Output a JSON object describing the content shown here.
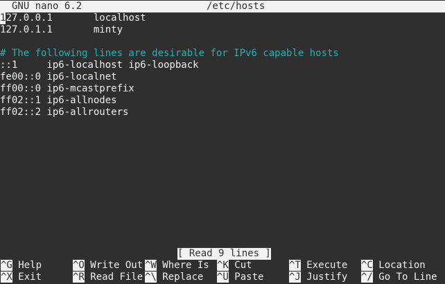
{
  "titlebar": {
    "app": "GNU nano 6.2",
    "file": "/etc/hosts"
  },
  "editor": {
    "cursor_char": "1",
    "lines": [
      {
        "text": "27.0.0.1       localhost",
        "comment": false
      },
      {
        "text": "127.0.1.1       minty",
        "comment": false
      },
      {
        "text": "",
        "comment": false
      },
      {
        "text": "# The following lines are desirable for IPv6 capable hosts",
        "comment": true
      },
      {
        "text": "::1     ip6-localhost ip6-loopback",
        "comment": false
      },
      {
        "text": "fe00::0 ip6-localnet",
        "comment": false
      },
      {
        "text": "ff00::0 ip6-mcastprefix",
        "comment": false
      },
      {
        "text": "ff02::1 ip6-allnodes",
        "comment": false
      },
      {
        "text": "ff02::2 ip6-allrouters",
        "comment": false
      }
    ]
  },
  "status": {
    "message": "[ Read 9 lines ]"
  },
  "shortcuts": {
    "row1": [
      {
        "key": "^G",
        "label": "Help"
      },
      {
        "key": "^O",
        "label": "Write Out"
      },
      {
        "key": "^W",
        "label": "Where Is"
      },
      {
        "key": "^K",
        "label": "Cut"
      },
      {
        "key": "^T",
        "label": "Execute"
      },
      {
        "key": "^C",
        "label": "Location"
      }
    ],
    "row2": [
      {
        "key": "^X",
        "label": "Exit"
      },
      {
        "key": "^R",
        "label": "Read File"
      },
      {
        "key": "^\\",
        "label": "Replace"
      },
      {
        "key": "^U",
        "label": "Paste"
      },
      {
        "key": "^J",
        "label": "Justify"
      },
      {
        "key": "^/",
        "label": "Go To Line"
      }
    ]
  }
}
